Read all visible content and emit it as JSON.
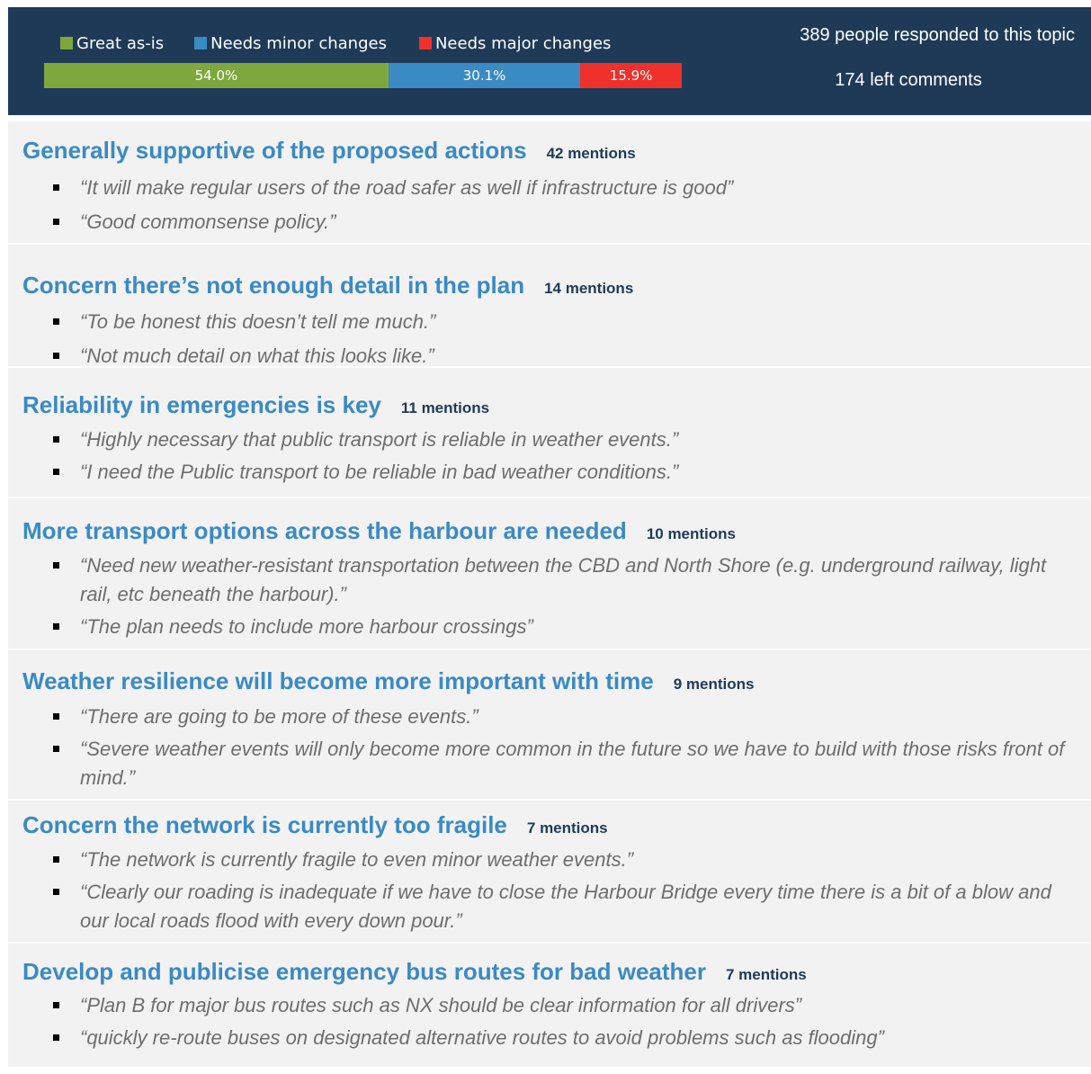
{
  "header": {
    "legend": [
      {
        "label": "Great as-is",
        "color": "#7ea83e"
      },
      {
        "label": "Needs minor changes",
        "color": "#3a8ac4"
      },
      {
        "label": "Needs major changes",
        "color": "#f0302a"
      }
    ],
    "bar": [
      {
        "label": "54.0%",
        "value": 54.0,
        "color": "#7ea83e"
      },
      {
        "label": "30.1%",
        "value": 30.1,
        "color": "#3a8ac4"
      },
      {
        "label": "15.9%",
        "value": 15.9,
        "color": "#f0302a"
      }
    ],
    "responded": "389 people responded to this topic",
    "comments": "174 left comments"
  },
  "themes": [
    {
      "title": "Generally supportive of the proposed actions",
      "mentions": "42 mentions",
      "quotes": [
        "“It will make regular users of the road safer as well if infrastructure is good”",
        "“Good commonsense policy.”"
      ]
    },
    {
      "title": "Concern there’s not enough detail in the plan",
      "mentions": "14 mentions",
      "quotes": [
        "“To be honest this doesn’t tell me much.”",
        "“Not much detail on what this looks like.”"
      ]
    },
    {
      "title": "Reliability in emergencies is key",
      "mentions": "11 mentions",
      "quotes": [
        "“Highly necessary that public transport is reliable in weather events.”",
        "“I need the Public transport to be reliable in bad weather conditions.”"
      ]
    },
    {
      "title": "More transport options across the harbour are needed",
      "mentions": "10 mentions",
      "quotes": [
        "“Need new weather-resistant transportation between the CBD and North Shore (e.g. underground railway, light rail, etc beneath the harbour).”",
        "“The plan needs to include more harbour crossings”"
      ]
    },
    {
      "title": "Weather resilience will become more important with time",
      "mentions": "9 mentions",
      "quotes": [
        "“There are going to be more of these events.”",
        "“Severe weather events will only become more common in the future so we have to build with those risks front of mind.”"
      ]
    },
    {
      "title": "Concern the network is currently too fragile",
      "mentions": "7 mentions",
      "quotes": [
        "“The network is currently fragile to even minor weather events.”",
        "“Clearly our roading is inadequate if we have to close the Harbour Bridge every time there is a bit of a blow and our local roads flood with every down pour.”"
      ]
    },
    {
      "title": "Develop and publicise emergency bus routes for bad weather",
      "mentions": "7 mentions",
      "quotes": [
        "“Plan B for major bus routes such as NX should be clear information for all drivers”",
        "“quickly re-route buses on designated alternative routes to avoid problems such as flooding”"
      ]
    }
  ]
}
